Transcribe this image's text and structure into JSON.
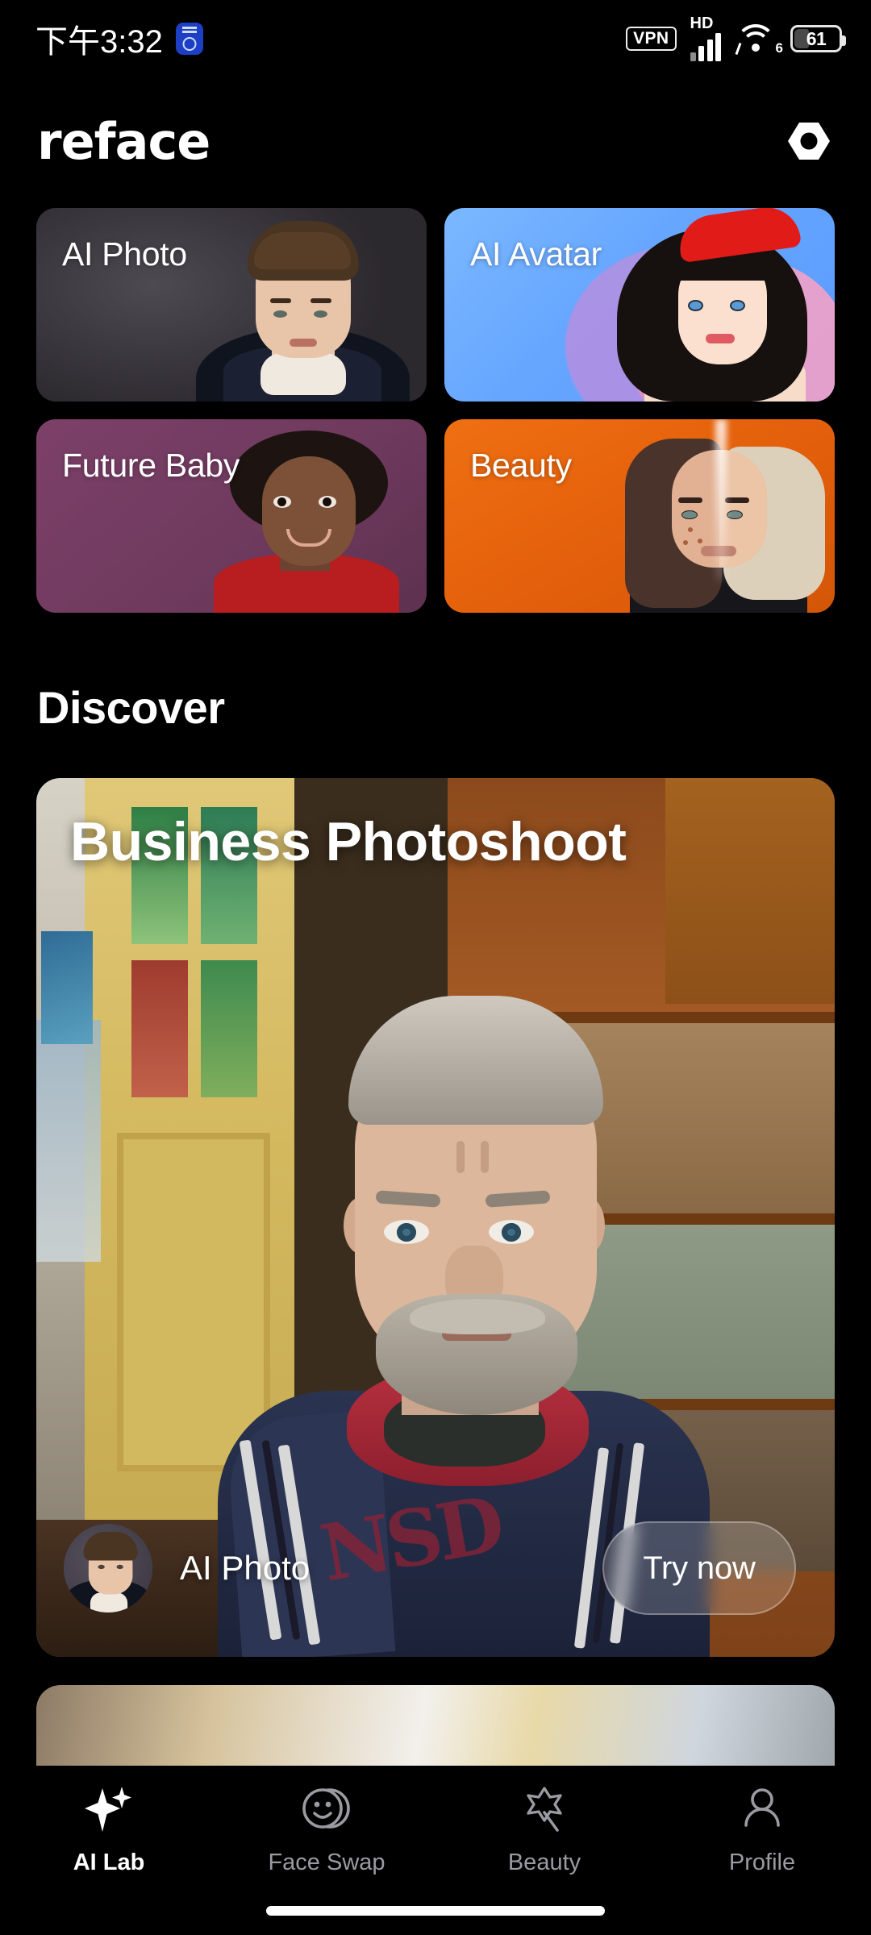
{
  "status_bar": {
    "time": "下午3:32",
    "badge_icon": "alarm-badge-icon",
    "vpn_label": "VPN",
    "hd_label": "HD",
    "wifi_generation": "6",
    "battery_percent": "61"
  },
  "header": {
    "logo": "reface",
    "settings_icon": "hex-nut-icon"
  },
  "feature_cards": [
    {
      "label": "AI Photo",
      "name": "ai-photo-card",
      "accent": "#39353c"
    },
    {
      "label": "AI Avatar",
      "name": "ai-avatar-card",
      "accent": "#66a6ff"
    },
    {
      "label": "Future Baby",
      "name": "future-baby-card",
      "accent": "#6f3a5e"
    },
    {
      "label": "Beauty",
      "name": "beauty-card",
      "accent": "#e35f0b"
    }
  ],
  "discover": {
    "section_title": "Discover",
    "featured": {
      "title": "Business Photoshoot",
      "avatar_alt": "ai-photo-thumbnail",
      "caption": "AI Photo",
      "cta_label": "Try now"
    }
  },
  "bottom_nav": {
    "items": [
      {
        "label": "AI Lab",
        "icon": "sparkle-icon",
        "active": true
      },
      {
        "label": "Face Swap",
        "icon": "smiley-faces-icon",
        "active": false
      },
      {
        "label": "Beauty",
        "icon": "magic-wand-icon",
        "active": false
      },
      {
        "label": "Profile",
        "icon": "person-icon",
        "active": false
      }
    ]
  }
}
